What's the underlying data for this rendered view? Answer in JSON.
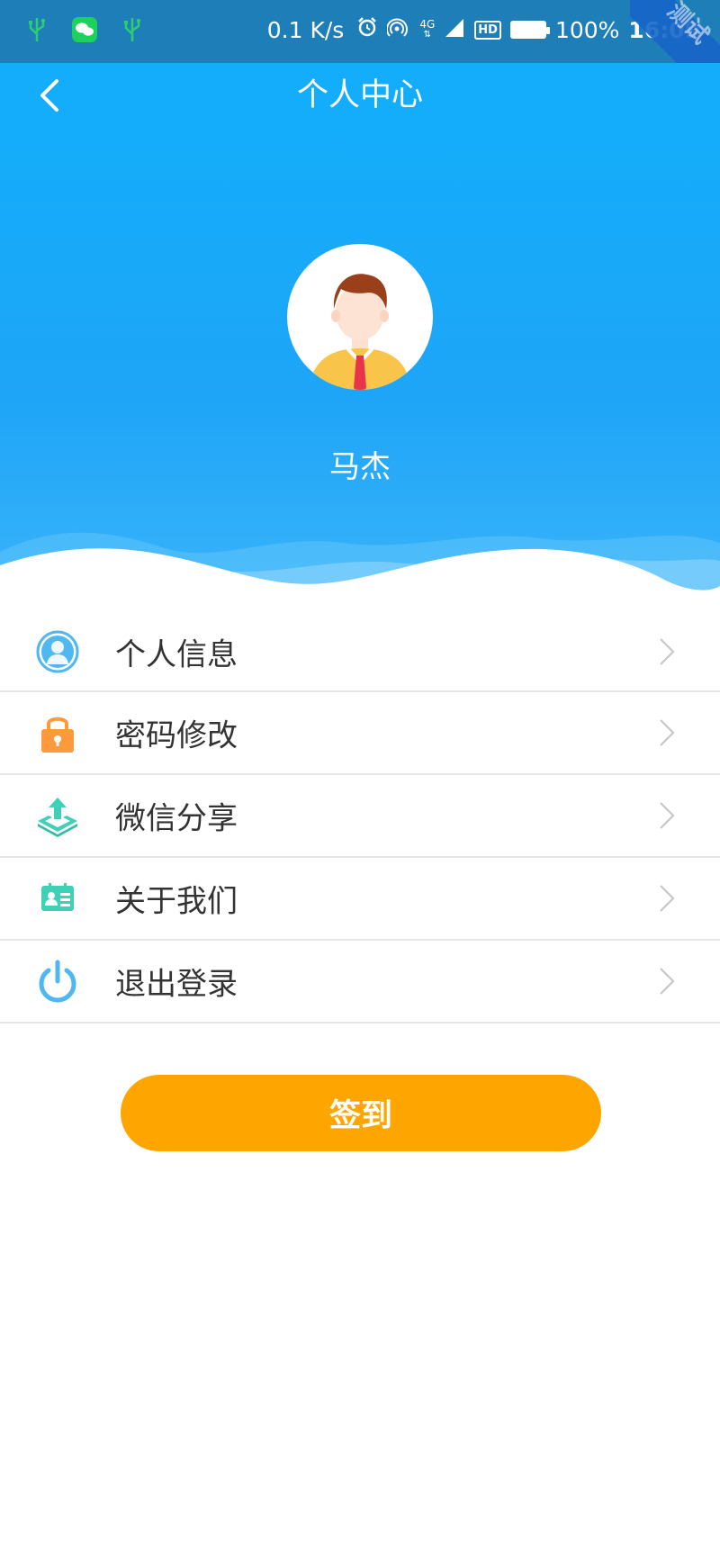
{
  "status_bar": {
    "network_speed": "0.1 K/s",
    "battery_percent": "100%",
    "time": "16:09",
    "network_type": "4G",
    "hd_label": "HD",
    "watermark": "测试",
    "icons": [
      "usb-icon",
      "wechat-icon",
      "usb-icon",
      "alarm-icon",
      "hotspot-icon",
      "signal-icon",
      "hd-icon",
      "battery-icon"
    ]
  },
  "header": {
    "title": "个人中心",
    "back_icon": "chevron-left-icon"
  },
  "profile": {
    "name": "马杰",
    "avatar_icon": "user-avatar-icon"
  },
  "menu": [
    {
      "label": "个人信息",
      "icon": "user-info-icon",
      "color": "#4fb8f0"
    },
    {
      "label": "密码修改",
      "icon": "lock-icon",
      "color": "#ff9a3c"
    },
    {
      "label": "微信分享",
      "icon": "share-upload-icon",
      "color": "#3fd1b5"
    },
    {
      "label": "关于我们",
      "icon": "id-card-icon",
      "color": "#3fd1b5"
    },
    {
      "label": "退出登录",
      "icon": "power-icon",
      "color": "#4fb8f0"
    }
  ],
  "signin_button": {
    "label": "签到",
    "color": "#ffa500"
  },
  "colors": {
    "primary": "#14adfb",
    "status_bar": "#1e7fb8",
    "accent": "#ffa500"
  }
}
